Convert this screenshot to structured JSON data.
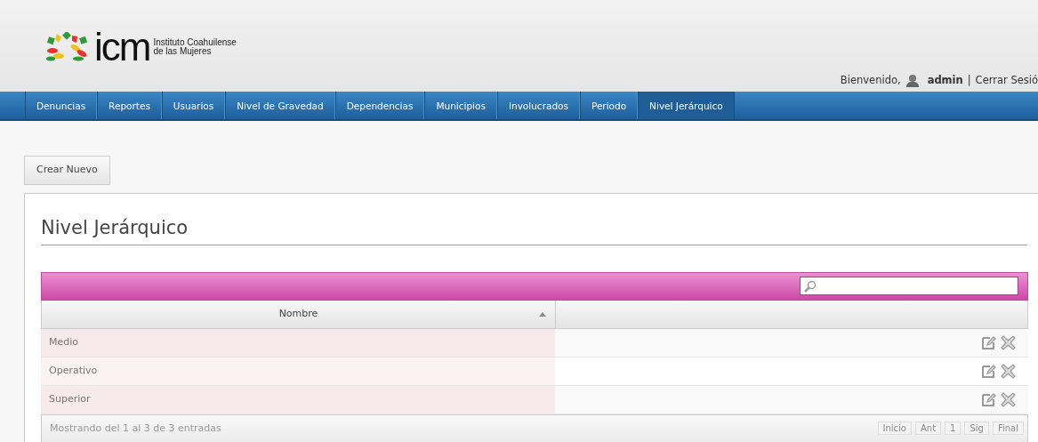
{
  "header": {
    "logo": {
      "mark": "icm",
      "line_1": "Instituto Coahuilense",
      "line_2": "de las Mujeres"
    },
    "greeting": "Bienvenido,",
    "user": "admin",
    "separator": "|",
    "logout": "Cerrar Sesió"
  },
  "nav": [
    {
      "label": "Denuncias",
      "selected": false
    },
    {
      "label": "Reportes",
      "selected": false
    },
    {
      "label": "Usuarios",
      "selected": false
    },
    {
      "label": "Nivel de Gravedad",
      "selected": false
    },
    {
      "label": "Dependencias",
      "selected": false
    },
    {
      "label": "Municipios",
      "selected": false
    },
    {
      "label": "Involucrados",
      "selected": false
    },
    {
      "label": "Periodo",
      "selected": false
    },
    {
      "label": "Nivel Jerárquico",
      "selected": true
    }
  ],
  "create_button": "Crear Nuevo",
  "panel": {
    "title": "Nivel Jerárquico",
    "table": {
      "columns": [
        {
          "label": "Nombre",
          "sorted": true
        },
        {}
      ],
      "rows": [
        {
          "name": "Medio"
        },
        {
          "name": "Operativo"
        },
        {
          "name": "Superior"
        }
      ],
      "info": "Mostrando del 1 al 3 de 3 entradas",
      "pager": [
        {
          "label": "Inicio",
          "disabled": true
        },
        {
          "label": "Ant",
          "disabled": true
        },
        {
          "label": "1",
          "disabled": true
        },
        {
          "label": "Sig",
          "disabled": true
        },
        {
          "label": "Final",
          "disabled": true
        }
      ]
    }
  }
}
